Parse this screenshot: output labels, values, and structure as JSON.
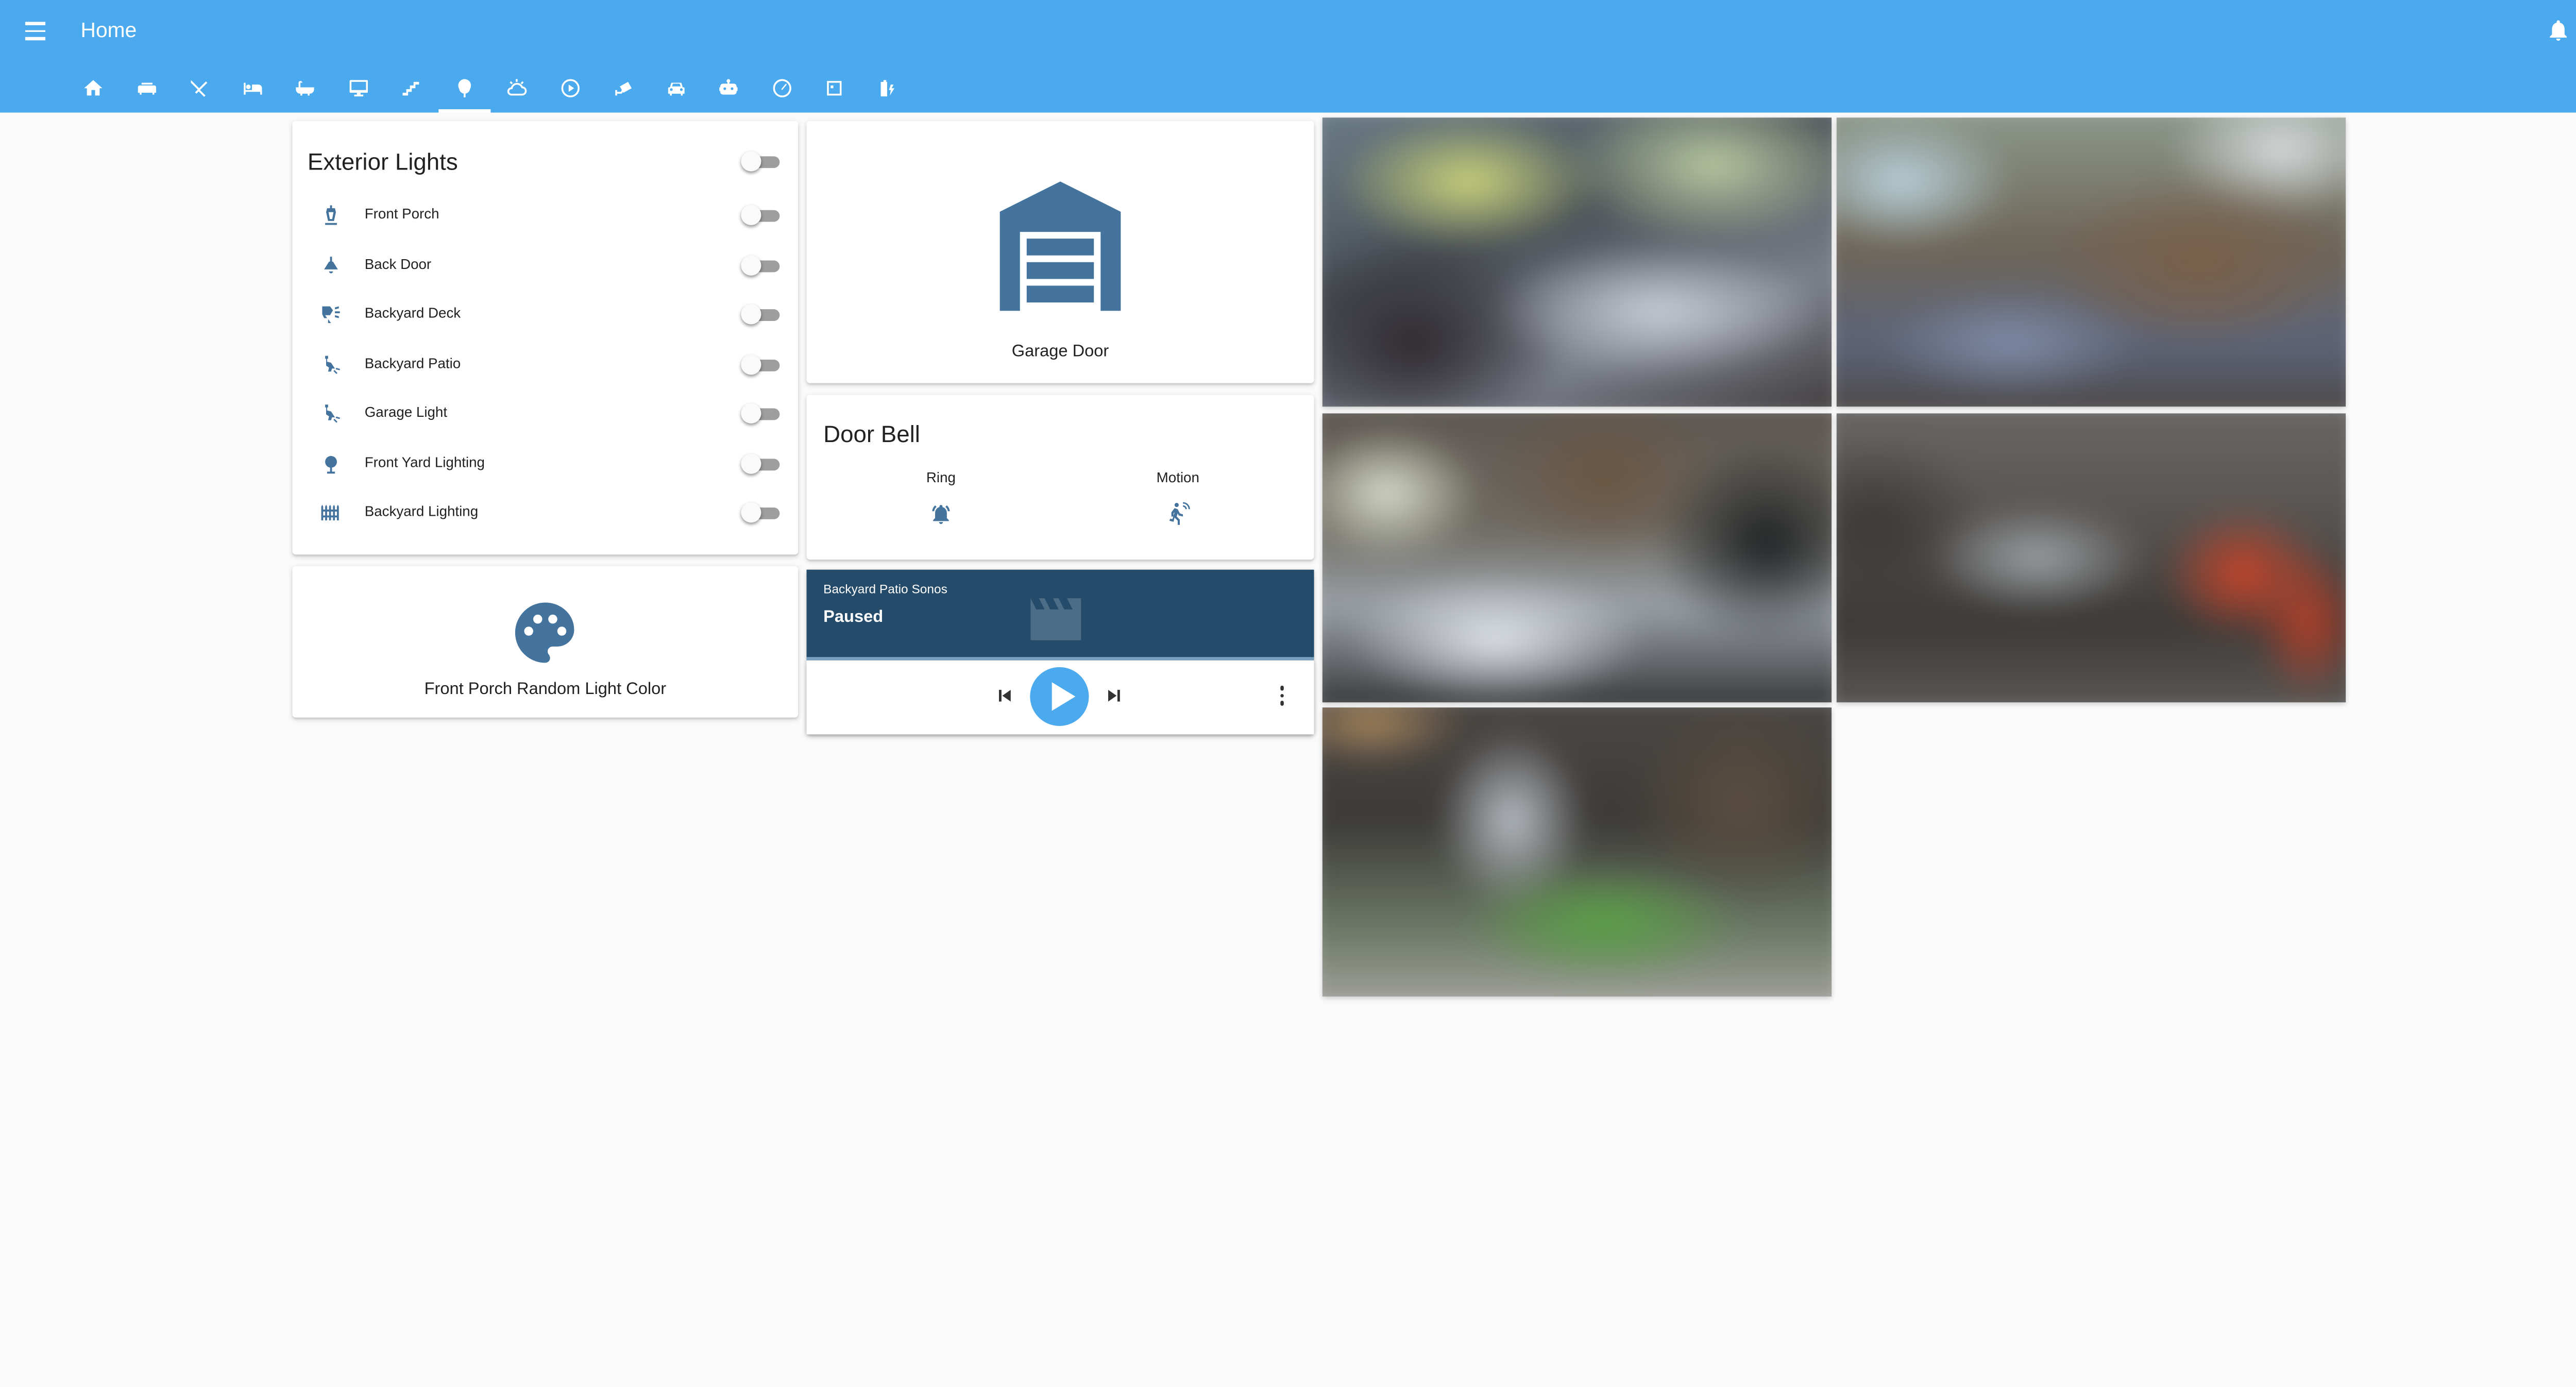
{
  "header": {
    "title": "Home"
  },
  "tabs": [
    {
      "icon": "home-icon"
    },
    {
      "icon": "sofa-icon"
    },
    {
      "icon": "silverware-icon"
    },
    {
      "icon": "bed-icon"
    },
    {
      "icon": "bathtub-icon"
    },
    {
      "icon": "monitor-icon"
    },
    {
      "icon": "stairs-icon"
    },
    {
      "icon": "tree-icon",
      "active": true
    },
    {
      "icon": "weather-icon"
    },
    {
      "icon": "play-circle-icon"
    },
    {
      "icon": "cctv-icon"
    },
    {
      "icon": "car-icon"
    },
    {
      "icon": "robot-icon"
    },
    {
      "icon": "gauge-icon"
    },
    {
      "icon": "calendar-icon"
    },
    {
      "icon": "battery-charging-icon"
    }
  ],
  "exterior_lights": {
    "title": "Exterior Lights",
    "master_on": false,
    "items": [
      {
        "name": "Front Porch",
        "icon": "porch-lamp-icon",
        "on": false
      },
      {
        "name": "Back Door",
        "icon": "ceiling-light-icon",
        "on": false
      },
      {
        "name": "Backyard Deck",
        "icon": "outdoor-lamp-icon",
        "on": false
      },
      {
        "name": "Backyard Patio",
        "icon": "wall-light-icon",
        "on": false
      },
      {
        "name": "Garage Light",
        "icon": "wall-light-icon",
        "on": false
      },
      {
        "name": "Front Yard Lighting",
        "icon": "lamp-post-icon",
        "on": false
      },
      {
        "name": "Backyard Lighting",
        "icon": "fence-icon",
        "on": false
      }
    ]
  },
  "porch_color": {
    "name": "Front Porch Random Light Color",
    "icon": "palette-icon"
  },
  "garage": {
    "name": "Garage Door",
    "icon": "garage-icon"
  },
  "doorbell": {
    "title": "Door Bell",
    "entities": [
      {
        "name": "Ring",
        "icon": "bell-ring-icon"
      },
      {
        "name": "Motion",
        "icon": "motion-walk-icon"
      }
    ]
  },
  "media": {
    "owner": "Backyard Patio Sonos",
    "state": "Paused"
  },
  "colors": {
    "header": "#4ba9ee",
    "icon": "#44739e",
    "media_bg": "#254b6b",
    "accent": "#4ba9ee",
    "background": "#fafafa"
  },
  "cameras": [
    {
      "name": "camera-1"
    },
    {
      "name": "camera-2"
    },
    {
      "name": "camera-3"
    },
    {
      "name": "camera-4"
    },
    {
      "name": "camera-5"
    }
  ]
}
